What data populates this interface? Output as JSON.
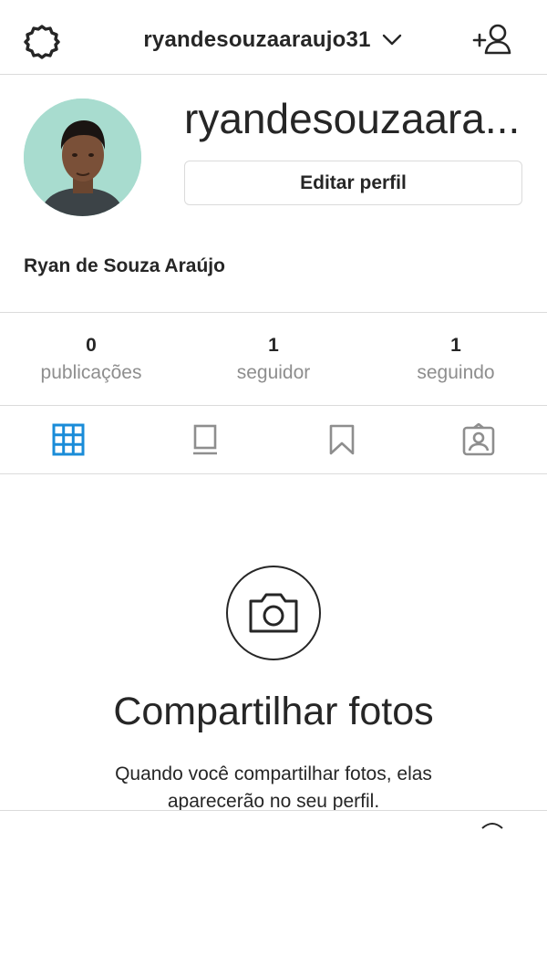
{
  "header": {
    "username": "ryandesouzaaraujo31",
    "settings_icon": "gear-icon",
    "dropdown_icon": "chevron-down-icon",
    "add_user_icon": "add-user-icon"
  },
  "profile": {
    "username_display": "ryandesouzaara...",
    "edit_button_label": "Editar perfil",
    "full_name": "Ryan de Souza Araújo"
  },
  "stats": [
    {
      "value": "0",
      "label": "publicações"
    },
    {
      "value": "1",
      "label": "seguidor"
    },
    {
      "value": "1",
      "label": "seguindo"
    }
  ],
  "tabs": [
    {
      "icon": "grid-icon",
      "active": true
    },
    {
      "icon": "feed-icon",
      "active": false
    },
    {
      "icon": "bookmark-icon",
      "active": false
    },
    {
      "icon": "tagged-icon",
      "active": false
    }
  ],
  "empty_state": {
    "icon": "camera-icon",
    "title": "Compartilhar fotos",
    "description": "Quando você compartilhar fotos, elas aparecerão no seu perfil."
  },
  "colors": {
    "accent": "#1a8cd8",
    "text": "#262626",
    "muted": "#8e8e8e",
    "border": "#dbdbdb"
  }
}
